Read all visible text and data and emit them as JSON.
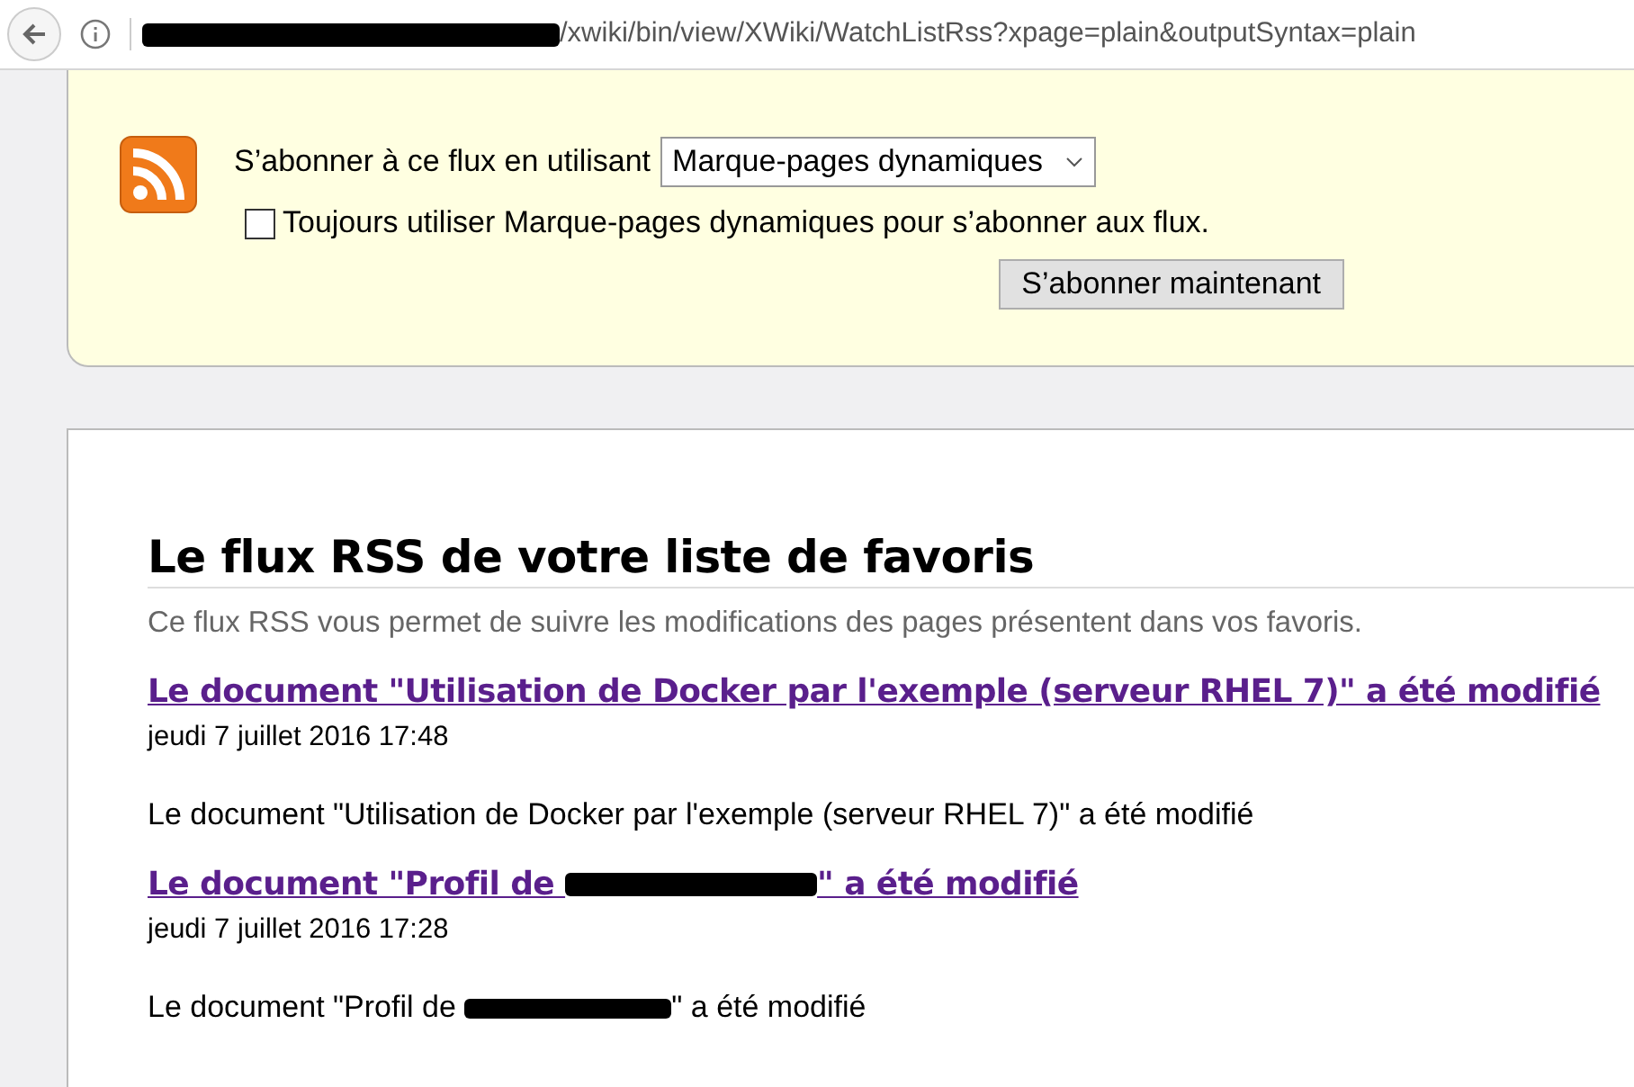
{
  "address_bar": {
    "url": [
      {
        "kind": "redaction"
      },
      {
        "kind": "text",
        "text": "/xwiki/bin/view/XWiki/WatchListRss?xpage=plain&outputSyntax=plain"
      }
    ]
  },
  "subscribe_panel": {
    "label": "S’abonner à ce flux en utilisant",
    "reader": "Marque-pages dynamiques",
    "always_use": {
      "label": "Toujours utiliser Marque-pages dynamiques pour s’abonner aux flux.",
      "checked": false
    },
    "button": "S’abonner maintenant"
  },
  "feed": {
    "title": "Le flux RSS de votre liste de favoris",
    "description": "Ce flux RSS vous permet de suivre les modifications des pages présentent dans vos favoris.",
    "entries": [
      {
        "title": [
          {
            "kind": "text",
            "text": "Le document \"Utilisation de Docker par l'exemple (serveur RHEL 7)\" a été modifié"
          }
        ],
        "date": "jeudi 7 juillet 2016 17:48",
        "summary": [
          {
            "kind": "text",
            "text": "Le document \"Utilisation de Docker par l'exemple (serveur RHEL 7)\" a été modifié"
          }
        ]
      },
      {
        "title": [
          {
            "kind": "text",
            "text": "Le document \"Profil de "
          },
          {
            "kind": "redaction"
          },
          {
            "kind": "text",
            "text": "\" a été modifié"
          }
        ],
        "date": "jeudi 7 juillet 2016 17:28",
        "summary": [
          {
            "kind": "text",
            "text": "Le document \"Profil de "
          },
          {
            "kind": "redaction"
          },
          {
            "kind": "text",
            "text": "\" a été modifié"
          }
        ]
      }
    ]
  }
}
